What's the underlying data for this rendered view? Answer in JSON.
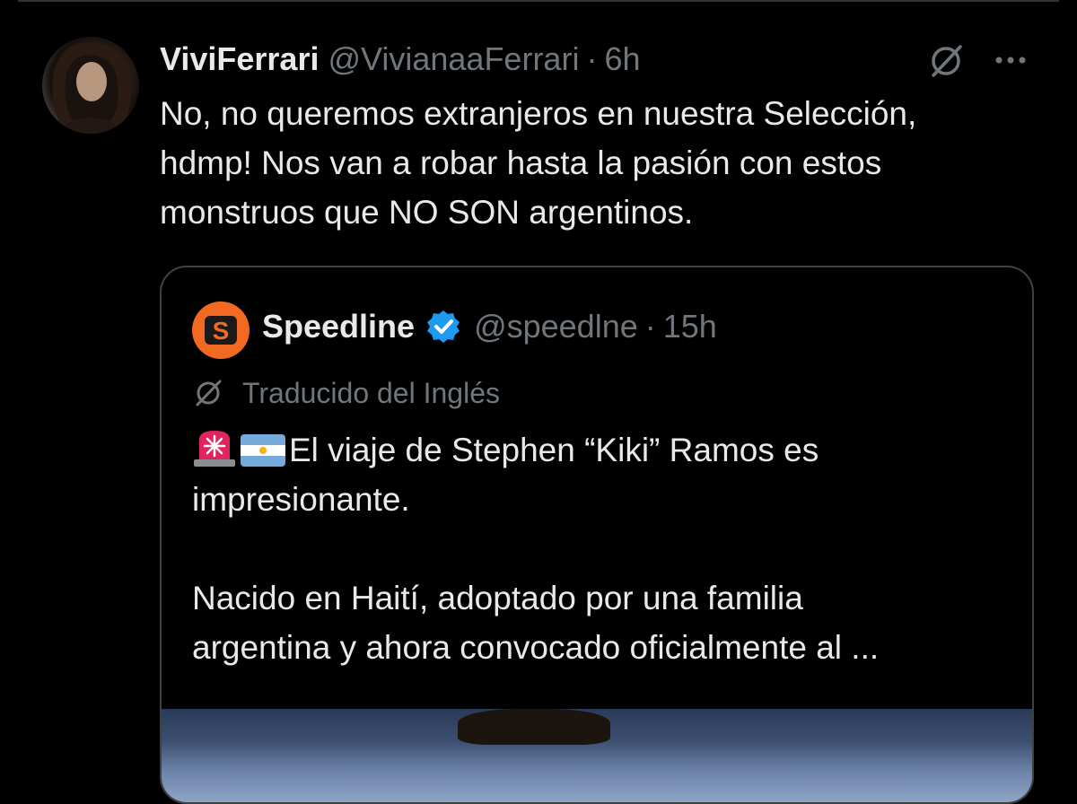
{
  "tweet": {
    "author_name": "ViviFerrari",
    "author_handle": "@VivianaaFerrari",
    "separator": "·",
    "timestamp": "6h",
    "text_lines": [
      "No, no queremos extranjeros en nuestra Selección,",
      "hdmp! Nos van a robar hasta la pasión con estos",
      "monstruos que NO SON argentinos."
    ],
    "icons": [
      "grok-icon",
      "more-icon"
    ]
  },
  "quoted_tweet": {
    "logo_letter": "S",
    "author_name": "Speedline",
    "author_handle": "@speedlne",
    "separator": "·",
    "timestamp": "15h",
    "translated_label": "Traducido del Inglés",
    "text_line_1": "El viaje de Stephen “Kiki” Ramos es",
    "text_line_2": "impresionante.",
    "text_line_3": "Nacido en Haití, adoptado por una familia",
    "text_line_4": "argentina y ahora convocado oficialmente al ...",
    "emojis": [
      "siren-emoji",
      "argentina-flag-emoji"
    ]
  },
  "colors": {
    "background": "#000000",
    "text_primary": "#e7e9ea",
    "text_secondary": "#71767b",
    "border": "#3e4144",
    "brand_orange": "#f26a21",
    "verified_blue": "#1d9bf0"
  }
}
